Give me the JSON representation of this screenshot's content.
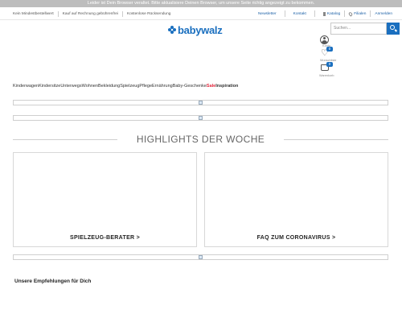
{
  "browser_warning": "Leider ist Dein Browser veraltet. Bitte aktualisiere Deinen Browser, um unsere Seite richtig angezeigt zu bekommen.",
  "utility": {
    "left_items": [
      "Kein Mindestbestellwert",
      "Kauf auf Rechnung gebührenfrei",
      "Kostenlose Rücksendung"
    ],
    "right_links": {
      "newsletter": "Newsletter",
      "kontakt": "Kontakt",
      "katalog": "Katalog",
      "filialen": "Filialen",
      "anmelden": "Anmelden"
    }
  },
  "logo": {
    "text": "babywalz"
  },
  "search": {
    "placeholder": "Suchen..."
  },
  "account": {
    "konto_label": "Konto",
    "wishlist_label": "Wunschliste",
    "wishlist_count": "0",
    "cart_label": "Warenkorb",
    "cart_count": "0"
  },
  "nav": {
    "items": [
      "Kinderwagen",
      "Kindersitze",
      "Unterwegs",
      "Wohnen",
      "Bekleidung",
      "Spielzeug",
      "Pflege",
      "Ernährung",
      "Baby-Geschenke"
    ],
    "sale": "Sale",
    "inspiration": "Inspiration"
  },
  "highlights": {
    "title": "HIGHLIGHTS DER WOCHE",
    "cards": [
      {
        "label": "SPIELZEUG-BERATER >"
      },
      {
        "label": "FAQ ZUM CORONAVIRUS >"
      }
    ]
  },
  "recommendations": {
    "title": "Unsere Empfehlungen für Dich"
  },
  "colors": {
    "brand_blue": "#1a6fbf",
    "sale_red": "#e3263b",
    "link_blue": "#1a5fa6"
  },
  "icons": [
    "search-icon",
    "account-icon",
    "heart-icon",
    "cart-icon",
    "catalog-icon",
    "location-pin-icon",
    "image-placeholder-icon"
  ]
}
